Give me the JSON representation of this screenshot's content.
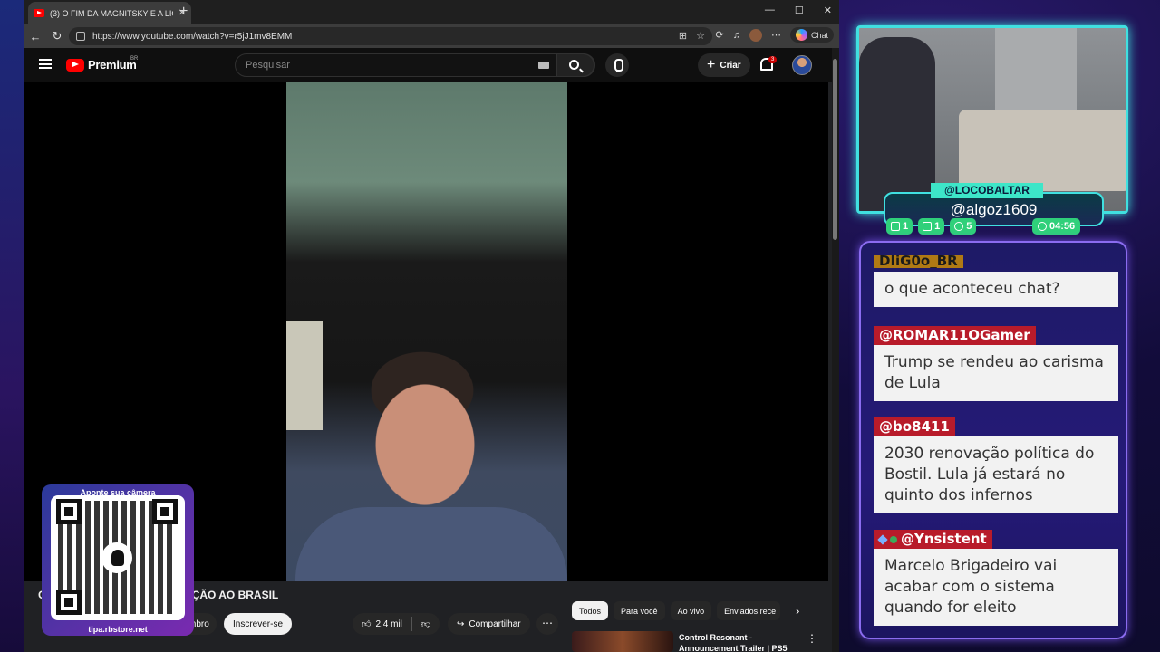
{
  "browser": {
    "tab_title": "(3) O FIM DA MAGNITSKY E A LIÇ",
    "url": "https://www.youtube.com/watch?v=r5jJ1mv8EMM",
    "chat_label": "Chat"
  },
  "youtube": {
    "logo_text": "Premium",
    "logo_region": "BR",
    "search_placeholder": "Pesquisar",
    "create_label": "Criar",
    "notif_count": "3",
    "video_title_visible_start": "O",
    "video_title_visible_end": "ÇÃO AO BRASIL",
    "join_label_partial": "mbro",
    "subscribe_label": "Inscrever-se",
    "like_count": "2,4 mil",
    "share_label": "Compartilhar",
    "chips": [
      "Todos",
      "Para você",
      "Ao vivo",
      "Enviados rece"
    ],
    "rec_title": "Control Resonant - Announcement Trailer | PS5"
  },
  "qr": {
    "top_text": "Aponte sua câmera",
    "bottom_text": "tipa.rbstore.net"
  },
  "stream": {
    "channel_tag": "@LOCOBALTAR",
    "handle": "@algoz1609",
    "stats": [
      "1",
      "1",
      "5"
    ],
    "timer": "04:56"
  },
  "chat": {
    "messages": [
      {
        "user": "DIiG0o_BR",
        "text": "o que aconteceu chat?"
      },
      {
        "user": "@ROMAR11OGamer",
        "text": "Trump se rendeu ao carisma de Lula"
      },
      {
        "user": "@bo8411",
        "text": "2030 renovação política do Bostil. Lula já estará no quinto dos infernos"
      },
      {
        "user": "@Ynsistent",
        "text": "Marcelo Brigadeiro vai acabar com o sistema quando for eleito"
      }
    ]
  }
}
